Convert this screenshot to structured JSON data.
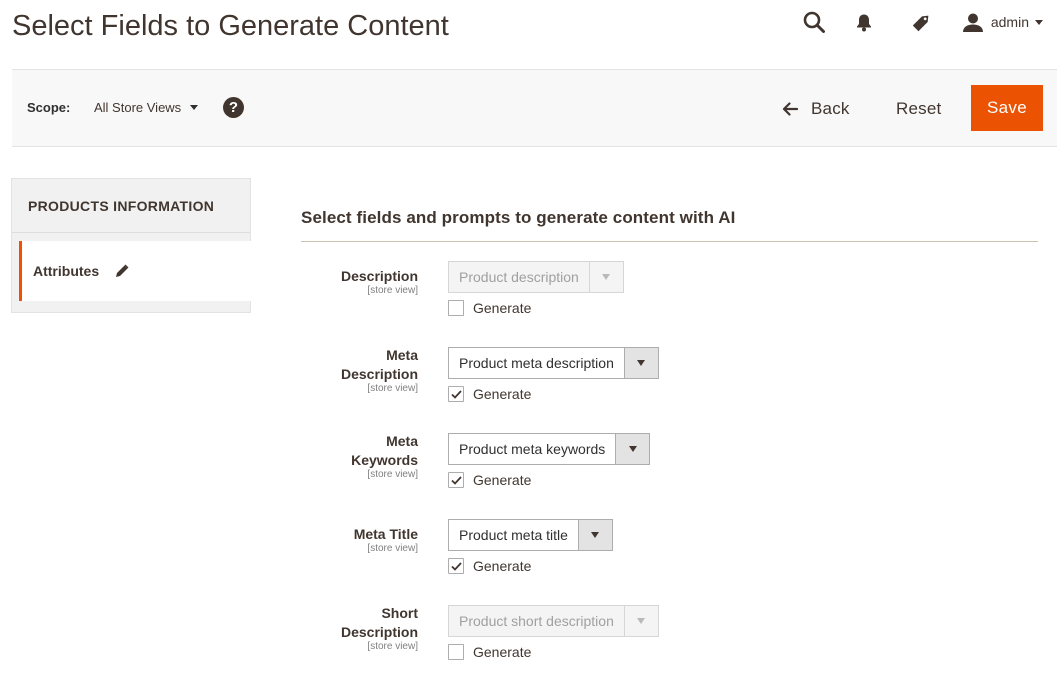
{
  "header": {
    "title": "Select Fields to Generate Content",
    "icons": [
      "search-icon",
      "bell-icon",
      "tag-icon",
      "user-icon"
    ],
    "user_name": "admin"
  },
  "action_bar": {
    "scope_label": "Scope:",
    "scope_value": "All Store Views",
    "help_glyph": "?",
    "back_label": "Back",
    "reset_label": "Reset",
    "save_label": "Save"
  },
  "sidebar": {
    "title": "PRODUCTS INFORMATION",
    "items": [
      {
        "label": "Attributes",
        "icon": "pencil-icon",
        "active": true
      }
    ]
  },
  "form": {
    "section_title": "Select fields and prompts to generate content with AI",
    "fields": [
      {
        "label_line1": "Description",
        "label_line2": "",
        "scope_note": "[store view]",
        "select_value": "Product description",
        "enabled": false,
        "generate_label": "Generate",
        "generate_checked": false
      },
      {
        "label_line1": "Meta",
        "label_line2": "Description",
        "scope_note": "[store view]",
        "select_value": "Product meta description",
        "enabled": true,
        "generate_label": "Generate",
        "generate_checked": true
      },
      {
        "label_line1": "Meta",
        "label_line2": "Keywords",
        "scope_note": "[store view]",
        "select_value": "Product meta keywords",
        "enabled": true,
        "generate_label": "Generate",
        "generate_checked": true
      },
      {
        "label_line1": "Meta Title",
        "label_line2": "",
        "scope_note": "[store view]",
        "select_value": "Product meta title",
        "enabled": true,
        "generate_label": "Generate",
        "generate_checked": true
      },
      {
        "label_line1": "Short",
        "label_line2": "Description",
        "scope_note": "[store view]",
        "select_value": "Product short description",
        "enabled": false,
        "generate_label": "Generate",
        "generate_checked": false
      }
    ]
  },
  "colors": {
    "accent": "#eb5202",
    "text_dark": "#41362f",
    "bar_bg": "#f8f8f8",
    "border": "#adadad"
  }
}
